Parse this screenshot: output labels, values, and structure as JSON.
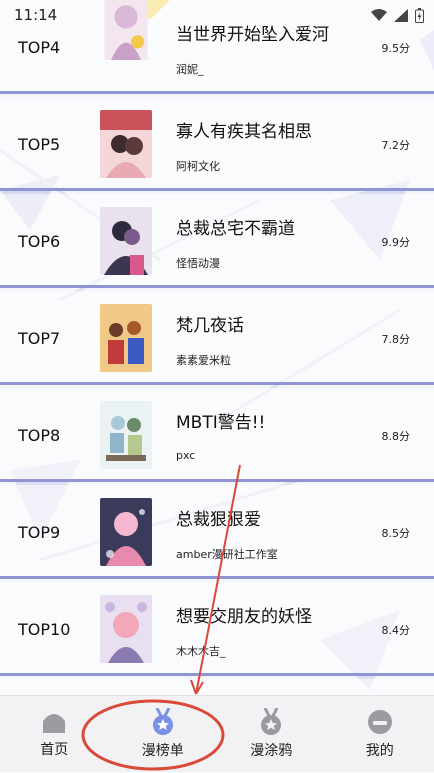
{
  "status_bar": {
    "time": "11:14",
    "icons": [
      "wifi-icon",
      "signal-icon",
      "battery-icon"
    ]
  },
  "ranking": [
    {
      "rank": "TOP4",
      "title": "当世界开始坠入爱河",
      "author": "润妮_",
      "score": "9.5分"
    },
    {
      "rank": "TOP5",
      "title": "寡人有疾其名相思",
      "author": "阿柯文化",
      "score": "7.2分"
    },
    {
      "rank": "TOP6",
      "title": "总裁总宅不霸道",
      "author": "怪悟动漫",
      "score": "9.9分"
    },
    {
      "rank": "TOP7",
      "title": "梵几夜话",
      "author": "素素爱米粒",
      "score": "7.8分"
    },
    {
      "rank": "TOP8",
      "title": "MBTI警告!!",
      "author": "pxc",
      "score": "8.8分"
    },
    {
      "rank": "TOP9",
      "title": "总裁狠狠爱",
      "author": "amber漫研社工作室",
      "score": "8.5分"
    },
    {
      "rank": "TOP10",
      "title": "想要交朋友的妖怪",
      "author": "木木木吉_",
      "score": "8.4分"
    }
  ],
  "tabbar": {
    "items": [
      {
        "label": "首页",
        "icon": "home-icon"
      },
      {
        "label": "漫榜单",
        "icon": "medal-icon"
      },
      {
        "label": "漫涂鸦",
        "icon": "badge-icon"
      },
      {
        "label": "我的",
        "icon": "profile-icon"
      }
    ]
  },
  "colors": {
    "divider": "#8f94d4",
    "accent": "#7b8fe6",
    "annotation": "#d94a3a"
  }
}
